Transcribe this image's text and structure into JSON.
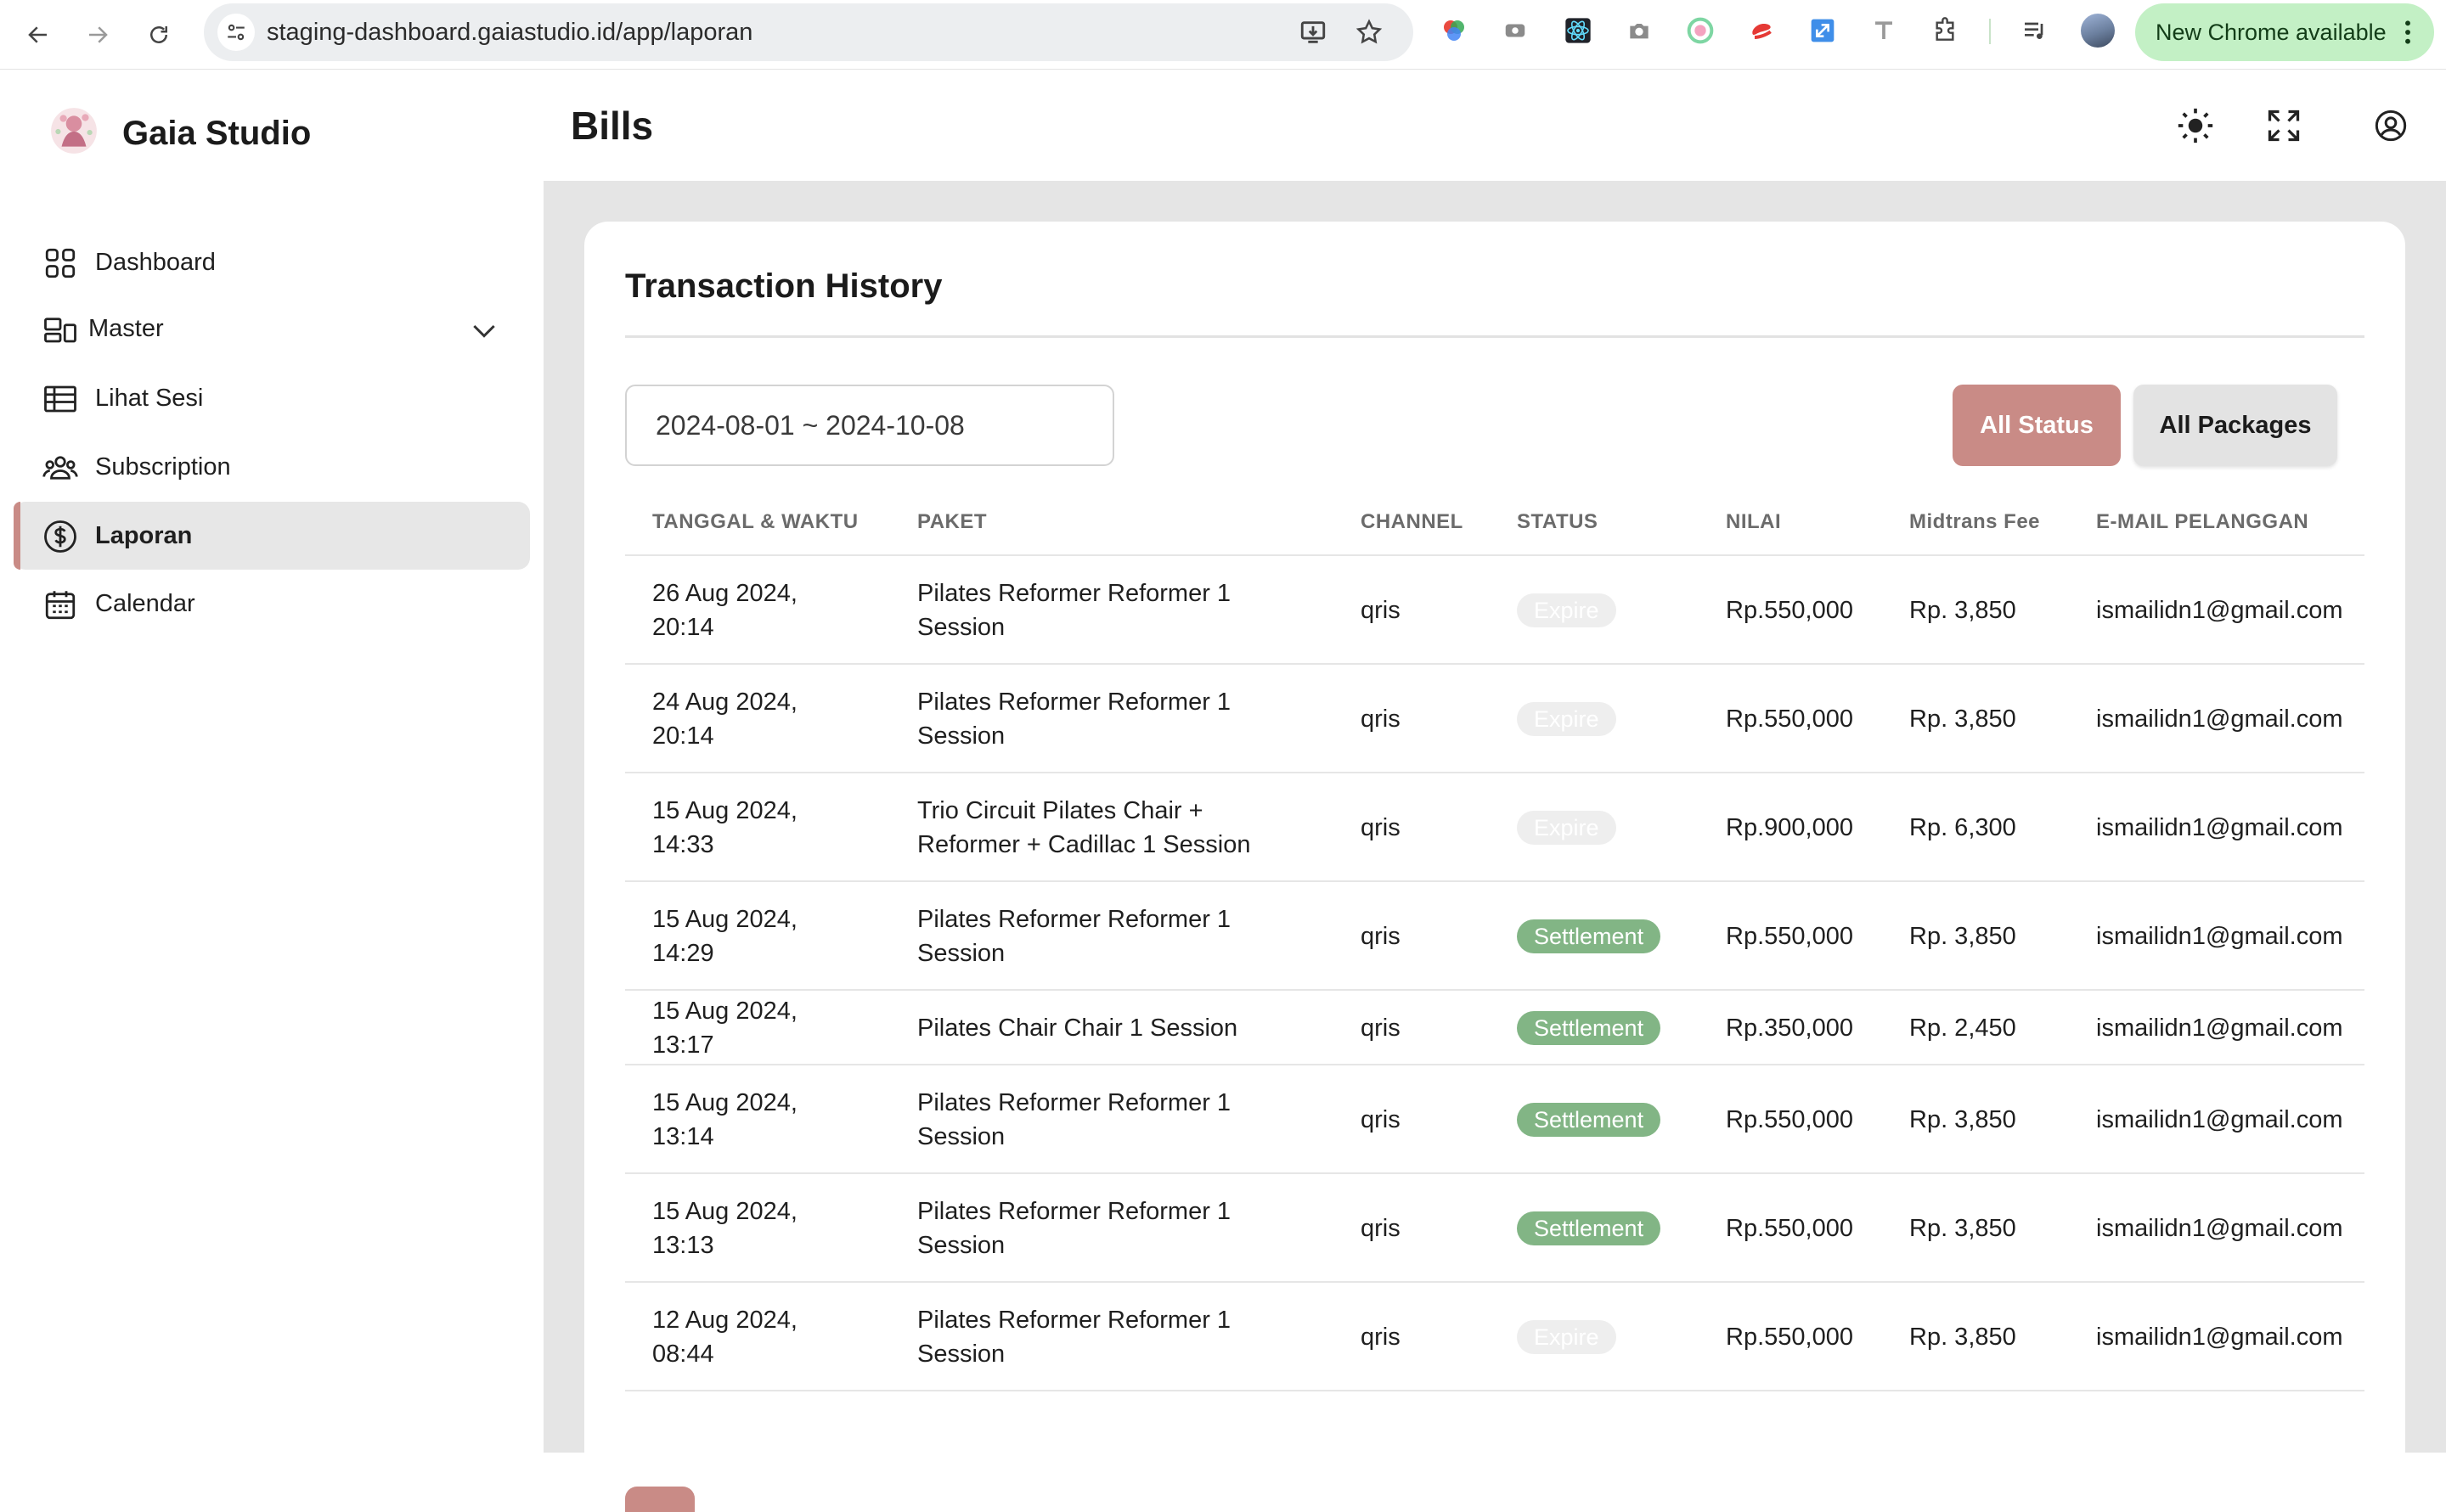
{
  "browser": {
    "url": "staging-dashboard.gaiastudio.id/app/laporan",
    "update_label": "New Chrome available"
  },
  "sidebar": {
    "brand": "Gaia Studio",
    "items": [
      {
        "label": "Dashboard",
        "icon": "grid-icon"
      },
      {
        "label": "Master",
        "icon": "layout-icon"
      },
      {
        "label": "Lihat Sesi",
        "icon": "table-icon"
      },
      {
        "label": "Subscription",
        "icon": "users-icon"
      },
      {
        "label": "Laporan",
        "icon": "dollar-icon",
        "active": true
      },
      {
        "label": "Calendar",
        "icon": "calendar-icon"
      }
    ]
  },
  "header": {
    "title": "Bills"
  },
  "card": {
    "title": "Transaction History",
    "date_range": "2024-08-01 ~ 2024-10-08",
    "status_filter": "All Status",
    "package_filter": "All Packages"
  },
  "table": {
    "columns": [
      "TANGGAL & WAKTU",
      "PAKET",
      "CHANNEL",
      "STATUS",
      "NILAI",
      "Midtrans Fee",
      "E-MAIL PELANGGAN"
    ],
    "rows": [
      {
        "date": "26 Aug 2024, 20:14",
        "package": "Pilates Reformer Reformer 1 Session",
        "channel": "qris",
        "status": "Expire",
        "value": "Rp.550,000",
        "fee": "Rp. 3,850",
        "email": "ismailidn1@gmail.com"
      },
      {
        "date": "24 Aug 2024, 20:14",
        "package": "Pilates Reformer Reformer 1 Session",
        "channel": "qris",
        "status": "Expire",
        "value": "Rp.550,000",
        "fee": "Rp. 3,850",
        "email": "ismailidn1@gmail.com"
      },
      {
        "date": "15 Aug 2024, 14:33",
        "package": "Trio Circuit Pilates Chair + Reformer + Cadillac 1 Session",
        "channel": "qris",
        "status": "Expire",
        "value": "Rp.900,000",
        "fee": "Rp. 6,300",
        "email": "ismailidn1@gmail.com"
      },
      {
        "date": "15 Aug 2024, 14:29",
        "package": "Pilates Reformer Reformer 1 Session",
        "channel": "qris",
        "status": "Settlement",
        "value": "Rp.550,000",
        "fee": "Rp. 3,850",
        "email": "ismailidn1@gmail.com"
      },
      {
        "date": "15 Aug 2024, 13:17",
        "package": "Pilates Chair Chair 1 Session",
        "channel": "qris",
        "status": "Settlement",
        "value": "Rp.350,000",
        "fee": "Rp. 2,450",
        "email": "ismailidn1@gmail.com"
      },
      {
        "date": "15 Aug 2024, 13:14",
        "package": "Pilates Reformer Reformer 1 Session",
        "channel": "qris",
        "status": "Settlement",
        "value": "Rp.550,000",
        "fee": "Rp. 3,850",
        "email": "ismailidn1@gmail.com"
      },
      {
        "date": "15 Aug 2024, 13:13",
        "package": "Pilates Reformer Reformer 1 Session",
        "channel": "qris",
        "status": "Settlement",
        "value": "Rp.550,000",
        "fee": "Rp. 3,850",
        "email": "ismailidn1@gmail.com"
      },
      {
        "date": "12 Aug 2024, 08:44",
        "package": "Pilates Reformer Reformer 1 Session",
        "channel": "qris",
        "status": "Expire",
        "value": "Rp.550,000",
        "fee": "Rp. 3,850",
        "email": "ismailidn1@gmail.com"
      }
    ]
  },
  "colors": {
    "accent": "#c98b86",
    "settlement": "#82b585",
    "expire": "#eeeeee",
    "content_bg": "#e5e5e5"
  }
}
